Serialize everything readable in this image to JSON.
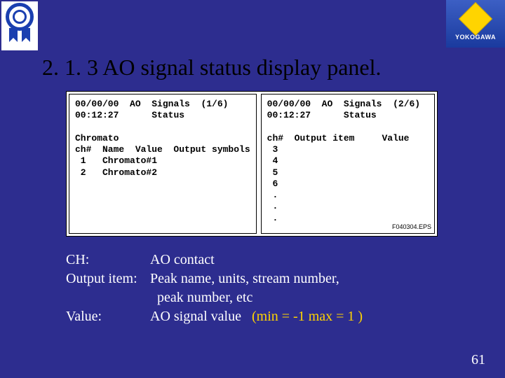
{
  "brand": "YOKOGAWA",
  "title": "2. 1. 3 AO signal status display panel.",
  "screenLeft": {
    "date": "00/00/00",
    "time": "00:12:27",
    "hdr1": "AO  Signals  (1/6)",
    "hdr2": "Status",
    "section": "Chromato",
    "cols": "ch#  Name  Value  Output symbols",
    "row1": " 1   Chromato#1",
    "row2": " 2   Chromato#2"
  },
  "screenRight": {
    "date": "00/00/00",
    "time": "00:12:27",
    "hdr1": "AO  Signals  (2/6)",
    "hdr2": "Status",
    "cols": "ch#  Output item     Value",
    "row1": " 3",
    "row2": " 4",
    "row3": " 5",
    "row4": " 6",
    "dot": " .",
    "corner": "F040304.EPS"
  },
  "legend": {
    "chLabel": "CH:",
    "chVal": "AO contact",
    "outLabel": "Output item:",
    "outVal": "Peak name, units, stream number,",
    "outVal2": "peak number, etc",
    "valLabel": "Value:",
    "valVal": "AO signal value",
    "minmax": "(min = -1     max = 1 )"
  },
  "pageNumber": "61"
}
